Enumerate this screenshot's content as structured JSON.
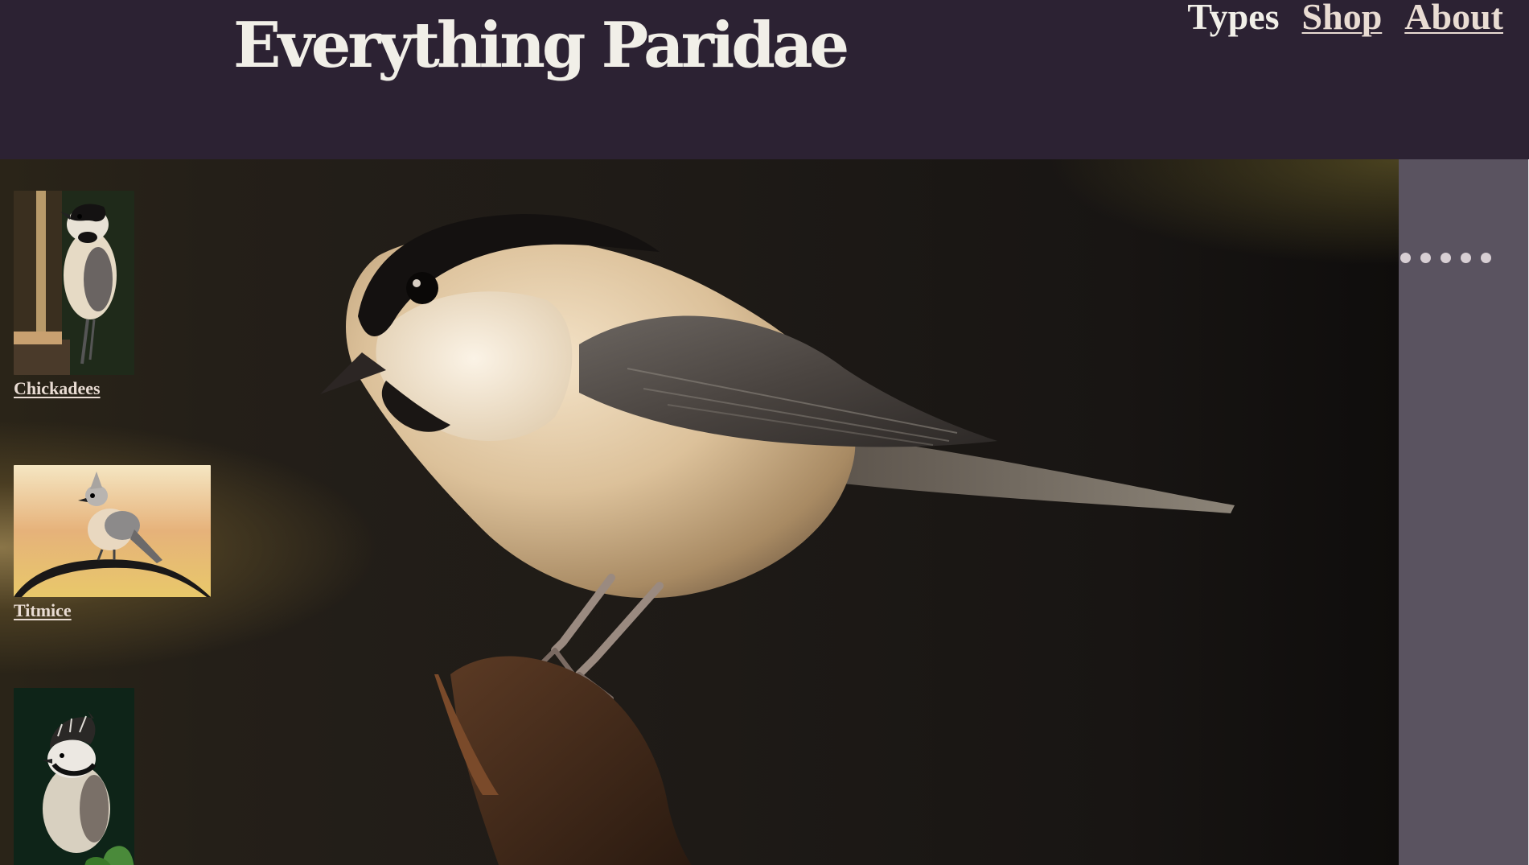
{
  "site": {
    "title": "Everything Paridae"
  },
  "nav": {
    "items": [
      {
        "label": "Types",
        "is_link": false
      },
      {
        "label": "Shop",
        "is_link": true
      },
      {
        "label": "About",
        "is_link": true
      }
    ]
  },
  "categories": [
    {
      "label": "Chickadees",
      "image": "chickadee-photo"
    },
    {
      "label": "Titmice",
      "image": "titmouse-photo"
    },
    {
      "label": "",
      "image": "crested-tit-photo"
    }
  ],
  "carousel": {
    "dot_count": 5,
    "hero_image": "chickadee-hero-photo"
  },
  "colors": {
    "header_bg": "#2c2233",
    "title_text": "#f1efe8",
    "link_text": "#e9dcd3",
    "side_panel": "#5a5360",
    "dot": "#d8cfd4"
  }
}
